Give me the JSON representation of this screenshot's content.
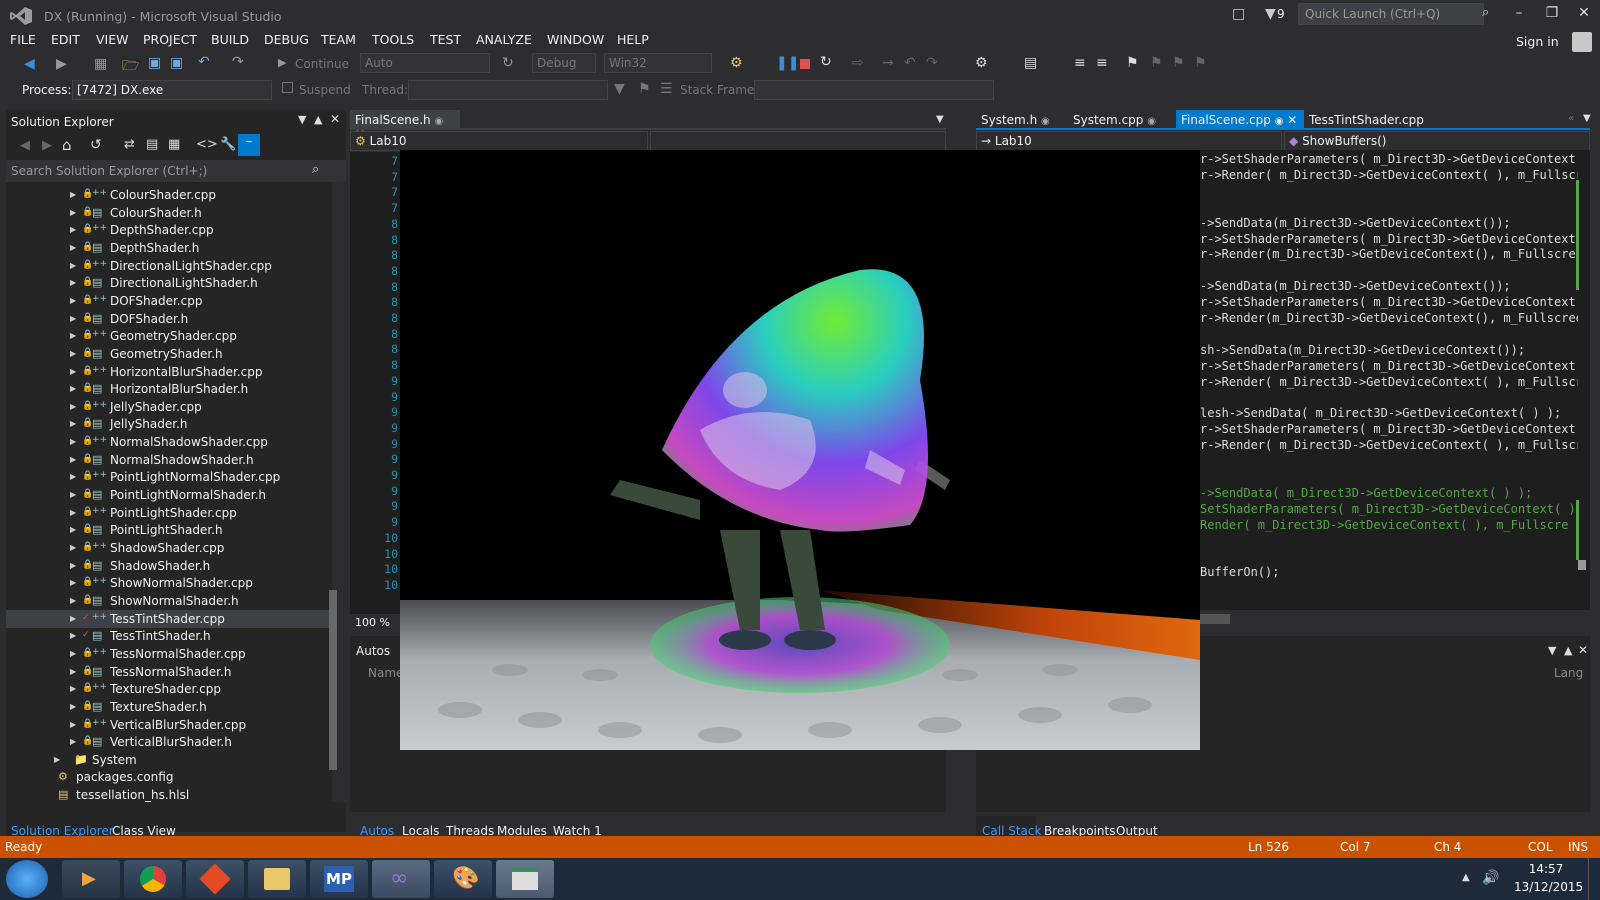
{
  "window": {
    "title": "DX (Running) - Microsoft Visual Studio",
    "notification_count": "9",
    "quick_launch_placeholder": "Quick Launch (Ctrl+Q)",
    "sign_in": "Sign in"
  },
  "menu": [
    "FILE",
    "EDIT",
    "VIEW",
    "PROJECT",
    "BUILD",
    "DEBUG",
    "TEAM",
    "TOOLS",
    "TEST",
    "ANALYZE",
    "WINDOW",
    "HELP"
  ],
  "toolbar": {
    "continue_label": "Continue",
    "solution_config": "Auto",
    "build_config": "Debug",
    "platform": "Win32"
  },
  "debugbar": {
    "process_label": "Process:",
    "process_value": "[7472] DX.exe",
    "suspend_label": "Suspend",
    "thread_label": "Thread:",
    "stack_frame_label": "Stack Frame:"
  },
  "solution_explorer": {
    "title": "Solution Explorer",
    "search_placeholder": "Search Solution Explorer (Ctrl+;)",
    "files": [
      {
        "name": "ColourShader.cpp",
        "kind": "cpp"
      },
      {
        "name": "ColourShader.h",
        "kind": "h"
      },
      {
        "name": "DepthShader.cpp",
        "kind": "cpp"
      },
      {
        "name": "DepthShader.h",
        "kind": "h"
      },
      {
        "name": "DirectionalLightShader.cpp",
        "kind": "cpp"
      },
      {
        "name": "DirectionalLightShader.h",
        "kind": "h"
      },
      {
        "name": "DOFShader.cpp",
        "kind": "cpp"
      },
      {
        "name": "DOFShader.h",
        "kind": "h"
      },
      {
        "name": "GeometryShader.cpp",
        "kind": "cpp"
      },
      {
        "name": "GeometryShader.h",
        "kind": "h"
      },
      {
        "name": "HorizontalBlurShader.cpp",
        "kind": "cpp"
      },
      {
        "name": "HorizontalBlurShader.h",
        "kind": "h"
      },
      {
        "name": "JellyShader.cpp",
        "kind": "cpp"
      },
      {
        "name": "JellyShader.h",
        "kind": "h"
      },
      {
        "name": "NormalShadowShader.cpp",
        "kind": "cpp"
      },
      {
        "name": "NormalShadowShader.h",
        "kind": "h"
      },
      {
        "name": "PointLightNormalShader.cpp",
        "kind": "cpp"
      },
      {
        "name": "PointLightNormalShader.h",
        "kind": "h"
      },
      {
        "name": "PointLightShader.cpp",
        "kind": "cpp"
      },
      {
        "name": "PointLightShader.h",
        "kind": "h"
      },
      {
        "name": "ShadowShader.cpp",
        "kind": "cpp"
      },
      {
        "name": "ShadowShader.h",
        "kind": "h"
      },
      {
        "name": "ShowNormalShader.cpp",
        "kind": "cpp"
      },
      {
        "name": "ShowNormalShader.h",
        "kind": "h"
      },
      {
        "name": "TessTintShader.cpp",
        "kind": "cpp"
      },
      {
        "name": "TessTintShader.h",
        "kind": "h"
      },
      {
        "name": "TessNormalShader.cpp",
        "kind": "cpp"
      },
      {
        "name": "TessNormalShader.h",
        "kind": "h"
      },
      {
        "name": "TextureShader.cpp",
        "kind": "cpp"
      },
      {
        "name": "TextureShader.h",
        "kind": "h"
      },
      {
        "name": "VerticalBlurShader.cpp",
        "kind": "cpp"
      },
      {
        "name": "VerticalBlurShader.h",
        "kind": "h"
      }
    ],
    "folder_system": "System",
    "packages_config": "packages.config",
    "tess_hs": "tessellation_hs.hlsl",
    "bottom_tabs": [
      "Solution Explorer",
      "Class View"
    ]
  },
  "left_editor": {
    "tab": "FinalScene.h",
    "nav_scope": "Lab10",
    "line_numbers": [
      "7",
      "7",
      "7",
      "7",
      "8",
      "8",
      "8",
      "8",
      "8",
      "8",
      "8",
      "8",
      "8",
      "8",
      "9",
      "9",
      "9",
      "9",
      "9",
      "9",
      "9",
      "9",
      "9",
      "9",
      "10",
      "10",
      "10",
      "10"
    ],
    "zoom": "100 %"
  },
  "right_editor": {
    "tabs": [
      "System.h",
      "System.cpp",
      "FinalScene.cpp",
      "TessTintShader.cpp"
    ],
    "active_tab": "FinalScene.cpp",
    "nav_scope": "Lab10",
    "nav_member": "ShowBuffers()",
    "code_lines": [
      {
        "text": "r->SetShaderParameters( m_Direct3D->GetDeviceContext(",
        "green": false
      },
      {
        "text": "r->Render( m_Direct3D->GetDeviceContext( ), m_Fullscre",
        "green": false
      },
      {
        "text": "",
        "green": false
      },
      {
        "text": "",
        "green": false
      },
      {
        "text": "->SendData(m_Direct3D->GetDeviceContext());",
        "green": false
      },
      {
        "text": "r->SetShaderParameters( m_Direct3D->GetDeviceContext(",
        "green": false
      },
      {
        "text": "r->Render(m_Direct3D->GetDeviceContext(), m_Fullscreen",
        "green": false
      },
      {
        "text": "",
        "green": false
      },
      {
        "text": "->SendData(m_Direct3D->GetDeviceContext());",
        "green": false
      },
      {
        "text": "r->SetShaderParameters( m_Direct3D->GetDeviceContext(",
        "green": false
      },
      {
        "text": "r->Render(m_Direct3D->GetDeviceContext(), m_Fullscreen",
        "green": false
      },
      {
        "text": "",
        "green": false
      },
      {
        "text": "sh->SendData(m_Direct3D->GetDeviceContext());",
        "green": false
      },
      {
        "text": "r->SetShaderParameters( m_Direct3D->GetDeviceContext(",
        "green": false
      },
      {
        "text": "r->Render( m_Direct3D->GetDeviceContext( ), m_Fullscre",
        "green": false
      },
      {
        "text": "",
        "green": false
      },
      {
        "text": "lesh->SendData( m_Direct3D->GetDeviceContext( ) );",
        "green": false
      },
      {
        "text": "r->SetShaderParameters( m_Direct3D->GetDeviceContext(",
        "green": false
      },
      {
        "text": "r->Render( m_Direct3D->GetDeviceContext( ), m_Fullscre",
        "green": false
      },
      {
        "text": "",
        "green": false
      },
      {
        "text": "",
        "green": false
      },
      {
        "text": "->SendData( m_Direct3D->GetDeviceContext( ) );",
        "green": true
      },
      {
        "text": "SetShaderParameters( m_Direct3D->GetDeviceContext( )",
        "green": true
      },
      {
        "text": "Render( m_Direct3D->GetDeviceContext( ), m_Fullscre",
        "green": true
      },
      {
        "text": "",
        "green": false
      },
      {
        "text": "",
        "green": false
      },
      {
        "text": "BufferOn();",
        "green": false
      }
    ]
  },
  "autos_panel": {
    "title": "Autos",
    "col_name": "Name",
    "bottom_tabs": [
      "Autos",
      "Locals",
      "Threads",
      "Modules",
      "Watch 1"
    ]
  },
  "callstack_panel": {
    "col_lang": "Lang",
    "bottom_tabs": [
      "Call Stack",
      "Breakpoints",
      "Output"
    ]
  },
  "statusbar": {
    "state": "Ready",
    "ln": "Ln 526",
    "col": "Col 7",
    "ch": "Ch 4",
    "mode": "COL",
    "ins": "INS"
  },
  "taskbar": {
    "time": "14:57",
    "date": "13/12/2015",
    "apps": [
      "start",
      "media",
      "chrome",
      "git",
      "explorer",
      "mp",
      "visual-studio",
      "paint",
      "dx-app"
    ]
  },
  "colors": {
    "status_bar": "#ca5100",
    "vs_purple": "#68217a",
    "accent_blue": "#007acc"
  }
}
